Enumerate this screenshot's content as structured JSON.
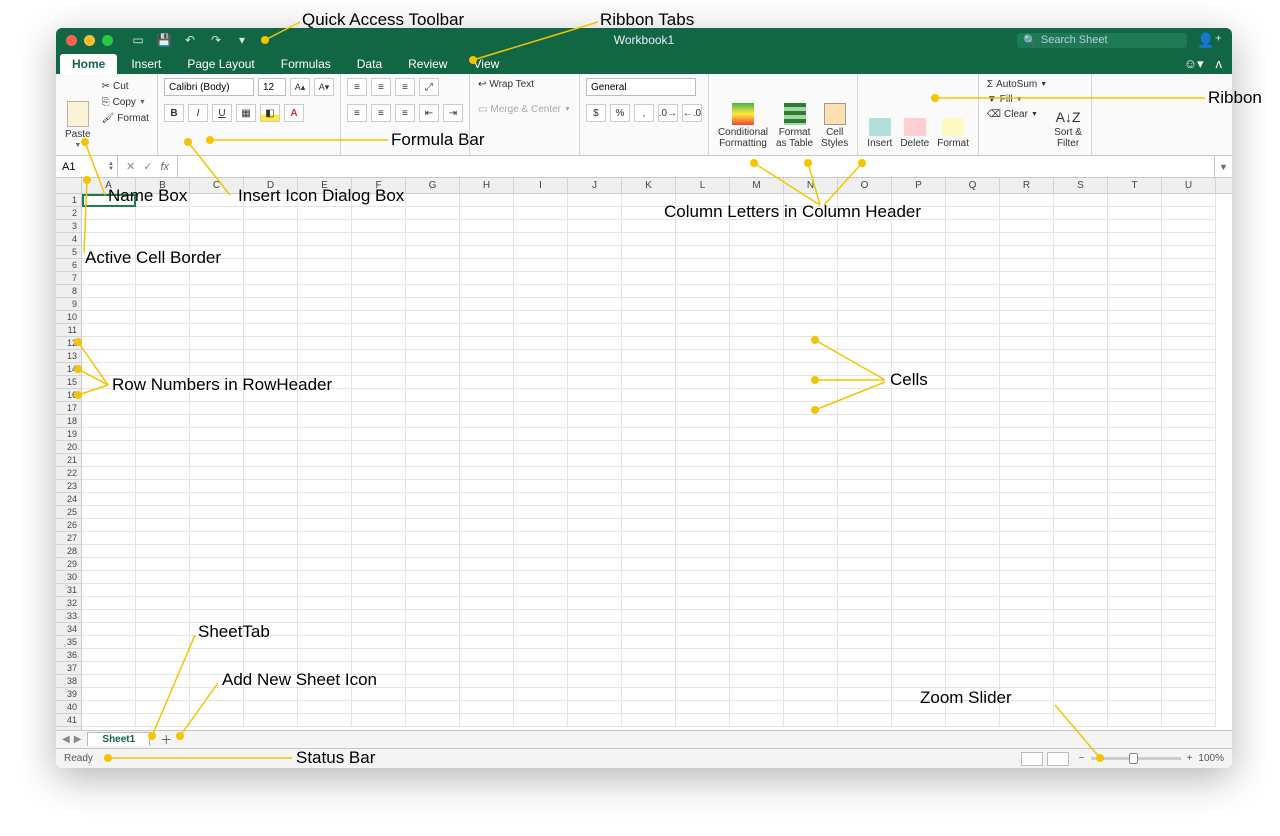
{
  "window": {
    "title": "Workbook1"
  },
  "search": {
    "placeholder": "Search Sheet"
  },
  "tabs": {
    "home": "Home",
    "insert": "Insert",
    "pagelayout": "Page Layout",
    "formulas": "Formulas",
    "data": "Data",
    "review": "Review",
    "view": "View"
  },
  "clipboard": {
    "paste": "Paste",
    "cut": "Cut",
    "copy": "Copy",
    "format": "Format"
  },
  "font": {
    "family": "Calibri (Body)",
    "size": "12"
  },
  "align": {
    "wrap": "Wrap Text",
    "merge": "Merge & Center"
  },
  "number": {
    "format": "General"
  },
  "styles": {
    "cond": "Conditional\nFormatting",
    "table": "Format\nas Table",
    "cell": "Cell\nStyles"
  },
  "cellsgrp": {
    "insert": "Insert",
    "delete": "Delete",
    "format": "Format"
  },
  "editing": {
    "autosum": "AutoSum",
    "fill": "Fill",
    "clear": "Clear",
    "sort": "Sort &\nFilter"
  },
  "namebox": {
    "value": "A1"
  },
  "columns": [
    "A",
    "B",
    "C",
    "D",
    "E",
    "F",
    "G",
    "H",
    "I",
    "J",
    "K",
    "L",
    "M",
    "N",
    "O",
    "P",
    "Q",
    "R",
    "S",
    "T",
    "U"
  ],
  "row_count": 41,
  "sheet": {
    "tab": "Sheet1"
  },
  "status": {
    "ready": "Ready",
    "zoom": "100%"
  },
  "annotations": {
    "qat": "Quick Access Toolbar",
    "ribtabs": "Ribbon Tabs",
    "ribbon": "Ribbon",
    "fbar": "Formula Bar",
    "namebox": "Name Box",
    "fxdlg": "Insert Icon Dialog Box",
    "colhdr": "Column Letters in Column Header",
    "activecell": "Active Cell Border",
    "rowhdr": "Row Numbers in RowHeader",
    "cells": "Cells",
    "sheettab": "SheetTab",
    "addsheet": "Add New Sheet Icon",
    "statusbar": "Status Bar",
    "zoom": "Zoom Slider"
  }
}
